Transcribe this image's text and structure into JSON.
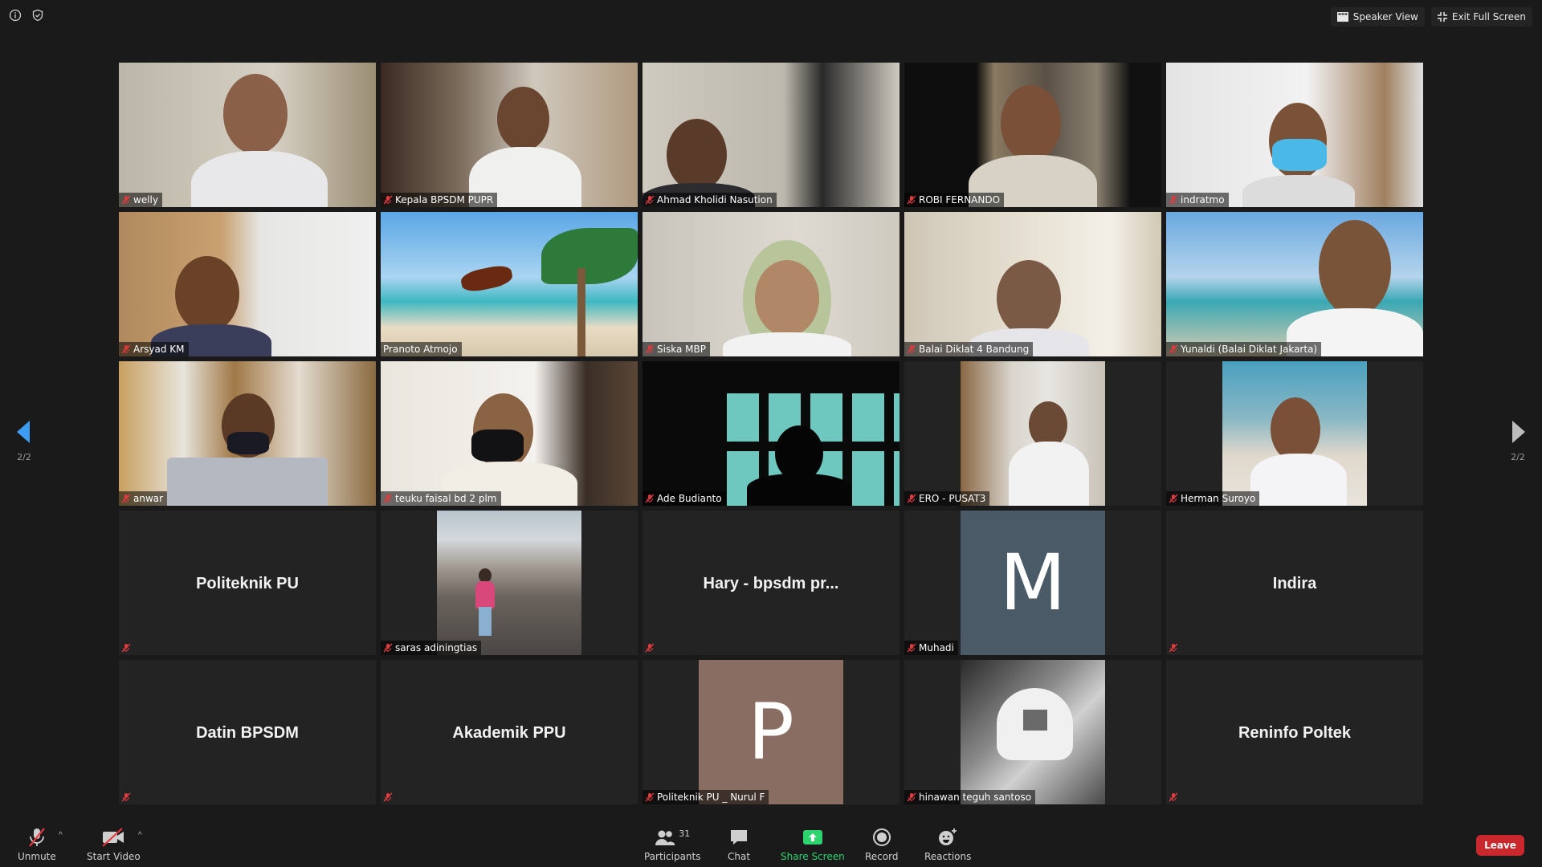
{
  "top_bar": {
    "speaker_view_label": "Speaker View",
    "exit_full_screen_label": "Exit Full Screen"
  },
  "pagination": {
    "left": "2/2",
    "right": "2/2"
  },
  "participants": [
    {
      "name": "welly",
      "kind": "video"
    },
    {
      "name": "Kepala BPSDM PUPR",
      "kind": "video"
    },
    {
      "name": "Ahmad Kholidi Nasution",
      "kind": "video"
    },
    {
      "name": "ROBI FERNANDO",
      "kind": "video"
    },
    {
      "name": "indratmo",
      "kind": "video"
    },
    {
      "name": "Arsyad KM",
      "kind": "video"
    },
    {
      "name": "Pranoto Atmojo",
      "kind": "video",
      "active_speaker": true
    },
    {
      "name": "Siska MBP",
      "kind": "video"
    },
    {
      "name": "Balai Diklat 4 Bandung",
      "kind": "video"
    },
    {
      "name": "Yunaldi (Balai Diklat Jakarta)",
      "kind": "video"
    },
    {
      "name": "anwar",
      "kind": "video"
    },
    {
      "name": "teuku faisal bd 2 plm",
      "kind": "video"
    },
    {
      "name": "Ade Budianto",
      "kind": "video"
    },
    {
      "name": "ERO - PUSAT3",
      "kind": "video"
    },
    {
      "name": "Herman Suroyo",
      "kind": "video"
    },
    {
      "name": "",
      "display_name": "Politeknik PU",
      "kind": "name-only"
    },
    {
      "name": "saras adiningtias",
      "kind": "photo"
    },
    {
      "name": "",
      "display_name": "Hary - bpsdm pr...",
      "kind": "name-only"
    },
    {
      "name": "Muhadi",
      "kind": "avatar",
      "letter": "M",
      "color": "#4a5a66"
    },
    {
      "name": "",
      "display_name": "Indira",
      "kind": "name-only"
    },
    {
      "name": "",
      "display_name": "Datin BPSDM",
      "kind": "name-only"
    },
    {
      "name": "",
      "display_name": "Akademik PPU",
      "kind": "name-only"
    },
    {
      "name": "Politeknik PU _ Nurul F",
      "kind": "avatar",
      "letter": "P",
      "color": "#8a6d62"
    },
    {
      "name": "hinawan teguh santoso",
      "kind": "photo"
    },
    {
      "name": "",
      "display_name": "Reninfo Poltek",
      "kind": "name-only"
    }
  ],
  "toolbar": {
    "unmute": "Unmute",
    "start_video": "Start Video",
    "participants": "Participants",
    "participants_count": "31",
    "chat": "Chat",
    "share_screen": "Share Screen",
    "record": "Record",
    "reactions": "Reactions",
    "leave": "Leave"
  },
  "colors": {
    "background": "#1a1a1a",
    "tile": "#232323",
    "active_speaker_border": "#e3e36b",
    "leave_red": "#c9292c",
    "share_green": "#2dd36f",
    "muted_red": "#e0393e"
  }
}
